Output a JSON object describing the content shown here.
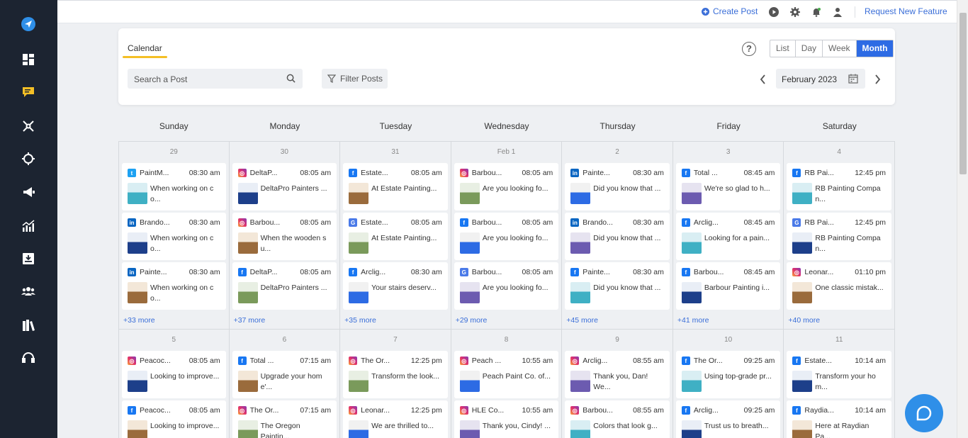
{
  "topbar": {
    "create_post": "Create Post",
    "request_feature": "Request New Feature"
  },
  "sidebar_icons": [
    "send-icon",
    "dashboard-icon",
    "chat-icon",
    "network-icon",
    "target-icon",
    "megaphone-icon",
    "analytics-icon",
    "inbox-icon",
    "team-icon",
    "library-icon",
    "support-icon"
  ],
  "calendar": {
    "tab": "Calendar",
    "search_placeholder": "Search a Post",
    "filter_label": "Filter Posts",
    "help": "?",
    "views": [
      "List",
      "Day",
      "Week",
      "Month"
    ],
    "active_view": "Month",
    "current_month": "February 2023",
    "weekdays": [
      "Sunday",
      "Monday",
      "Tuesday",
      "Wednesday",
      "Thursday",
      "Friday",
      "Saturday"
    ]
  },
  "weeks": [
    {
      "days": [
        {
          "num": "29",
          "more": "+33 more",
          "posts": [
            {
              "net": "tw",
              "acct": "PaintM...",
              "time": "08:30 am",
              "text": "When working on c o..."
            },
            {
              "net": "li",
              "acct": "Brando...",
              "time": "08:30 am",
              "text": "When working on c o..."
            },
            {
              "net": "li",
              "acct": "Painte...",
              "time": "08:30 am",
              "text": "When working on c o..."
            }
          ]
        },
        {
          "num": "30",
          "more": "+37 more",
          "posts": [
            {
              "net": "ig",
              "acct": "DeltaP...",
              "time": "08:05 am",
              "text": "DeltaPro Painters ..."
            },
            {
              "net": "ig",
              "acct": "Barbou...",
              "time": "08:05 am",
              "text": "When the wooden s u..."
            },
            {
              "net": "fb",
              "acct": "DeltaP...",
              "time": "08:05 am",
              "text": "DeltaPro Painters ..."
            }
          ]
        },
        {
          "num": "31",
          "more": "+35 more",
          "posts": [
            {
              "net": "fb",
              "acct": "Estate...",
              "time": "08:05 am",
              "text": "At Estate Painting..."
            },
            {
              "net": "gb",
              "acct": "Estate...",
              "time": "08:05 am",
              "text": "At Estate Painting..."
            },
            {
              "net": "fb",
              "acct": "Arclig...",
              "time": "08:30 am",
              "text": "Your stairs deserv..."
            }
          ]
        },
        {
          "num": "Feb 1",
          "more": "+29 more",
          "posts": [
            {
              "net": "ig",
              "acct": "Barbou...",
              "time": "08:05 am",
              "text": "Are you looking fo..."
            },
            {
              "net": "fb",
              "acct": "Barbou...",
              "time": "08:05 am",
              "text": "Are you looking fo..."
            },
            {
              "net": "gb",
              "acct": "Barbou...",
              "time": "08:05 am",
              "text": "Are you looking fo..."
            }
          ]
        },
        {
          "num": "2",
          "more": "+45 more",
          "posts": [
            {
              "net": "li",
              "acct": "Painte...",
              "time": "08:30 am",
              "text": "Did you know that ..."
            },
            {
              "net": "li",
              "acct": "Brando...",
              "time": "08:30 am",
              "text": "Did you know that ..."
            },
            {
              "net": "fb",
              "acct": "Painte...",
              "time": "08:30 am",
              "text": "Did you know that ..."
            }
          ]
        },
        {
          "num": "3",
          "more": "+41 more",
          "posts": [
            {
              "net": "fb",
              "acct": "Total ...",
              "time": "08:45 am",
              "text": "We're so glad to h..."
            },
            {
              "net": "fb",
              "acct": "Arclig...",
              "time": "08:45 am",
              "text": "Looking for a pain..."
            },
            {
              "net": "fb",
              "acct": "Barbou...",
              "time": "08:45 am",
              "text": "Barbour Painting i..."
            }
          ]
        },
        {
          "num": "4",
          "more": "+40 more",
          "posts": [
            {
              "net": "fb",
              "acct": "RB Pai...",
              "time": "12:45 pm",
              "text": "RB Painting Compa n..."
            },
            {
              "net": "gb",
              "acct": "RB Pai...",
              "time": "12:45 pm",
              "text": "RB Painting Compa n..."
            },
            {
              "net": "ig",
              "acct": "Leonar...",
              "time": "01:10 pm",
              "text": "One classic mistak..."
            }
          ]
        }
      ]
    },
    {
      "days": [
        {
          "num": "5",
          "posts": [
            {
              "net": "ig",
              "acct": "Peacoc...",
              "time": "08:05 am",
              "text": "Looking to improve..."
            },
            {
              "net": "fb",
              "acct": "Peacoc...",
              "time": "08:05 am",
              "text": "Looking to improve..."
            }
          ]
        },
        {
          "num": "6",
          "posts": [
            {
              "net": "fb",
              "acct": "Total ...",
              "time": "07:15 am",
              "text": "Upgrade your hom e'..."
            },
            {
              "net": "ig",
              "acct": "The Or...",
              "time": "07:15 am",
              "text": "The Oregon Paintin..."
            }
          ]
        },
        {
          "num": "7",
          "posts": [
            {
              "net": "ig",
              "acct": "The Or...",
              "time": "12:25 pm",
              "text": "Transform the look..."
            },
            {
              "net": "ig",
              "acct": "Leonar...",
              "time": "12:25 pm",
              "text": "We are thrilled to..."
            }
          ]
        },
        {
          "num": "8",
          "posts": [
            {
              "net": "ig",
              "acct": "Peach ...",
              "time": "10:55 am",
              "text": "Peach Paint Co. of..."
            },
            {
              "net": "ig",
              "acct": "HLE Co...",
              "time": "10:55 am",
              "text": "Thank you, Cindy! ..."
            }
          ]
        },
        {
          "num": "9",
          "posts": [
            {
              "net": "ig",
              "acct": "Arclig...",
              "time": "08:55 am",
              "text": "Thank you, Dan! We..."
            },
            {
              "net": "ig",
              "acct": "Barbou...",
              "time": "08:55 am",
              "text": "Colors that look g..."
            }
          ]
        },
        {
          "num": "10",
          "posts": [
            {
              "net": "fb",
              "acct": "The Or...",
              "time": "09:25 am",
              "text": "Using top-grade pr..."
            },
            {
              "net": "fb",
              "acct": "Arclig...",
              "time": "09:25 am",
              "text": "Trust us to breath..."
            }
          ]
        },
        {
          "num": "11",
          "posts": [
            {
              "net": "fb",
              "acct": "Estate...",
              "time": "10:14 am",
              "text": "Transform your ho m..."
            },
            {
              "net": "fb",
              "acct": "Raydia...",
              "time": "10:14 am",
              "text": "Here at Raydian Pa..."
            }
          ]
        }
      ]
    }
  ],
  "colors": {
    "sidebar": "#1c2431",
    "accent": "#2d6be4",
    "tab_underline": "#f4bf26",
    "link": "#3a6ed8"
  }
}
